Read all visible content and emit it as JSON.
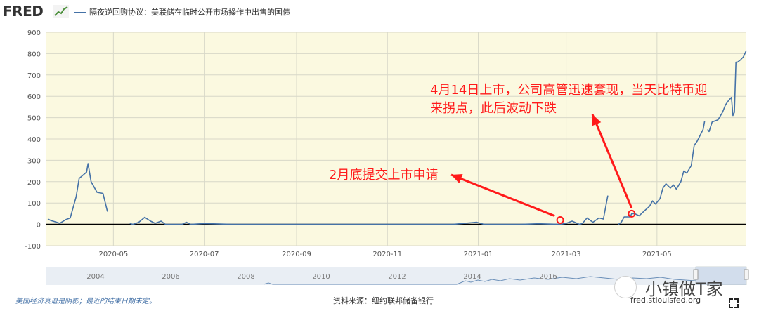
{
  "header": {
    "logo": "FRED",
    "series_title": "隔夜逆回购协议：美联储在临时公开市场操作中出售的国债"
  },
  "footer": {
    "recession_note": "美国经济衰退是阴影；最近的结束日期未定。",
    "source": "资料来源：纽约联邦储备银行",
    "site": "fred.stlouisfed.org"
  },
  "watermark": {
    "text": "小镇做T家"
  },
  "annotations": [
    {
      "text_lines": [
        "4月14日上市，公司高管迅速套现，当天比特币迎",
        "来拐点，此后波动下跌"
      ],
      "x": "2021-04-14",
      "y": 50
    },
    {
      "text_lines": [
        "2月底提交上市申请"
      ],
      "x": "2021-02-25",
      "y": 20
    }
  ],
  "colors": {
    "plot_bg": "#fbf9e0",
    "series": "#4572a7",
    "annotation": "#ff1a1a",
    "nav_bg": "#e9eef4"
  },
  "chart_data": {
    "type": "line",
    "x_axis": {
      "min": "2020-03-17",
      "max": "2021-06-30",
      "tick_labels": [
        "2020-05",
        "2020-07",
        "2020-09",
        "2020-11",
        "2021-01",
        "2021-03",
        "2021-05"
      ],
      "tick_dates": [
        "2020-05-01",
        "2020-07-01",
        "2020-09-01",
        "2020-11-01",
        "2021-01-01",
        "2021-03-01",
        "2021-05-01"
      ]
    },
    "y_axis": {
      "min": -100,
      "max": 900,
      "tick_labels": [
        "900",
        "800",
        "700",
        "600",
        "500",
        "400",
        "300",
        "200",
        "100",
        "0",
        "-100"
      ],
      "ticks": [
        900,
        800,
        700,
        600,
        500,
        400,
        300,
        200,
        100,
        0,
        -100
      ]
    },
    "grid": true,
    "navigator_labels": [
      "2004",
      "2006",
      "2008",
      "2010",
      "2012",
      "2014",
      "2016"
    ],
    "series": [
      {
        "values": [
          [
            "2020-03-18",
            25
          ],
          [
            "2020-03-20",
            18
          ],
          [
            "2020-03-24",
            10
          ],
          [
            "2020-03-26",
            5
          ],
          [
            "2020-03-30",
            22
          ],
          [
            "2020-04-02",
            30
          ],
          [
            "2020-04-06",
            130
          ],
          [
            "2020-04-08",
            215
          ],
          [
            "2020-04-13",
            245
          ],
          [
            "2020-04-14",
            285
          ],
          [
            "2020-04-16",
            200
          ],
          [
            "2020-04-20",
            150
          ],
          [
            "2020-04-24",
            145
          ],
          [
            "2020-04-27",
            60
          ],
          null,
          [
            "2020-05-12",
            5
          ],
          [
            "2020-05-14",
            0
          ],
          [
            "2020-05-18",
            10
          ],
          [
            "2020-05-22",
            33
          ],
          [
            "2020-05-26",
            15
          ],
          [
            "2020-05-29",
            5
          ],
          [
            "2020-06-02",
            15
          ],
          [
            "2020-06-05",
            0
          ],
          [
            "2020-06-10",
            0
          ],
          [
            "2020-06-16",
            0
          ],
          [
            "2020-06-19",
            10
          ],
          [
            "2020-06-22",
            0
          ],
          [
            "2020-07-01",
            4
          ],
          [
            "2020-07-20",
            0
          ],
          [
            "2020-08-15",
            0
          ],
          [
            "2020-09-15",
            0
          ],
          [
            "2020-10-15",
            0
          ],
          [
            "2020-11-15",
            0
          ],
          [
            "2020-12-15",
            0
          ],
          [
            "2020-12-31",
            10
          ],
          [
            "2021-01-05",
            0
          ],
          [
            "2021-01-29",
            0
          ],
          [
            "2021-02-10",
            3
          ],
          [
            "2021-02-25",
            0
          ],
          [
            "2021-03-01",
            5
          ],
          [
            "2021-03-05",
            15
          ],
          [
            "2021-03-10",
            0
          ],
          [
            "2021-03-12",
            5
          ],
          [
            "2021-03-15",
            30
          ],
          [
            "2021-03-19",
            10
          ],
          [
            "2021-03-23",
            30
          ],
          [
            "2021-03-26",
            25
          ],
          [
            "2021-03-29",
            135
          ],
          null,
          [
            "2021-04-05",
            0
          ],
          [
            "2021-04-07",
            10
          ],
          [
            "2021-04-09",
            35
          ],
          [
            "2021-04-13",
            35
          ],
          [
            "2021-04-14",
            50
          ],
          [
            "2021-04-16",
            50
          ],
          [
            "2021-04-19",
            40
          ],
          [
            "2021-04-22",
            60
          ],
          [
            "2021-04-26",
            85
          ],
          [
            "2021-04-28",
            110
          ],
          [
            "2021-04-30",
            95
          ],
          [
            "2021-05-03",
            120
          ],
          [
            "2021-05-05",
            170
          ],
          [
            "2021-05-07",
            190
          ],
          [
            "2021-05-10",
            170
          ],
          [
            "2021-05-12",
            185
          ],
          [
            "2021-05-14",
            165
          ],
          [
            "2021-05-17",
            200
          ],
          [
            "2021-05-19",
            250
          ],
          [
            "2021-05-21",
            240
          ],
          [
            "2021-05-24",
            275
          ],
          [
            "2021-05-26",
            370
          ],
          [
            "2021-05-28",
            390
          ],
          [
            "2021-06-01",
            445
          ],
          [
            "2021-06-02",
            485
          ],
          null,
          [
            "2021-06-04",
            445
          ],
          [
            "2021-06-05",
            435
          ],
          [
            "2021-06-07",
            480
          ],
          [
            "2021-06-09",
            485
          ],
          [
            "2021-06-11",
            490
          ],
          [
            "2021-06-14",
            525
          ],
          [
            "2021-06-16",
            560
          ],
          [
            "2021-06-18",
            580
          ],
          [
            "2021-06-20",
            595
          ],
          [
            "2021-06-21",
            510
          ],
          [
            "2021-06-22",
            525
          ],
          [
            "2021-06-23",
            760
          ],
          [
            "2021-06-24",
            760
          ],
          [
            "2021-06-26",
            770
          ],
          [
            "2021-06-28",
            785
          ],
          [
            "2021-06-30",
            815
          ]
        ]
      }
    ]
  }
}
